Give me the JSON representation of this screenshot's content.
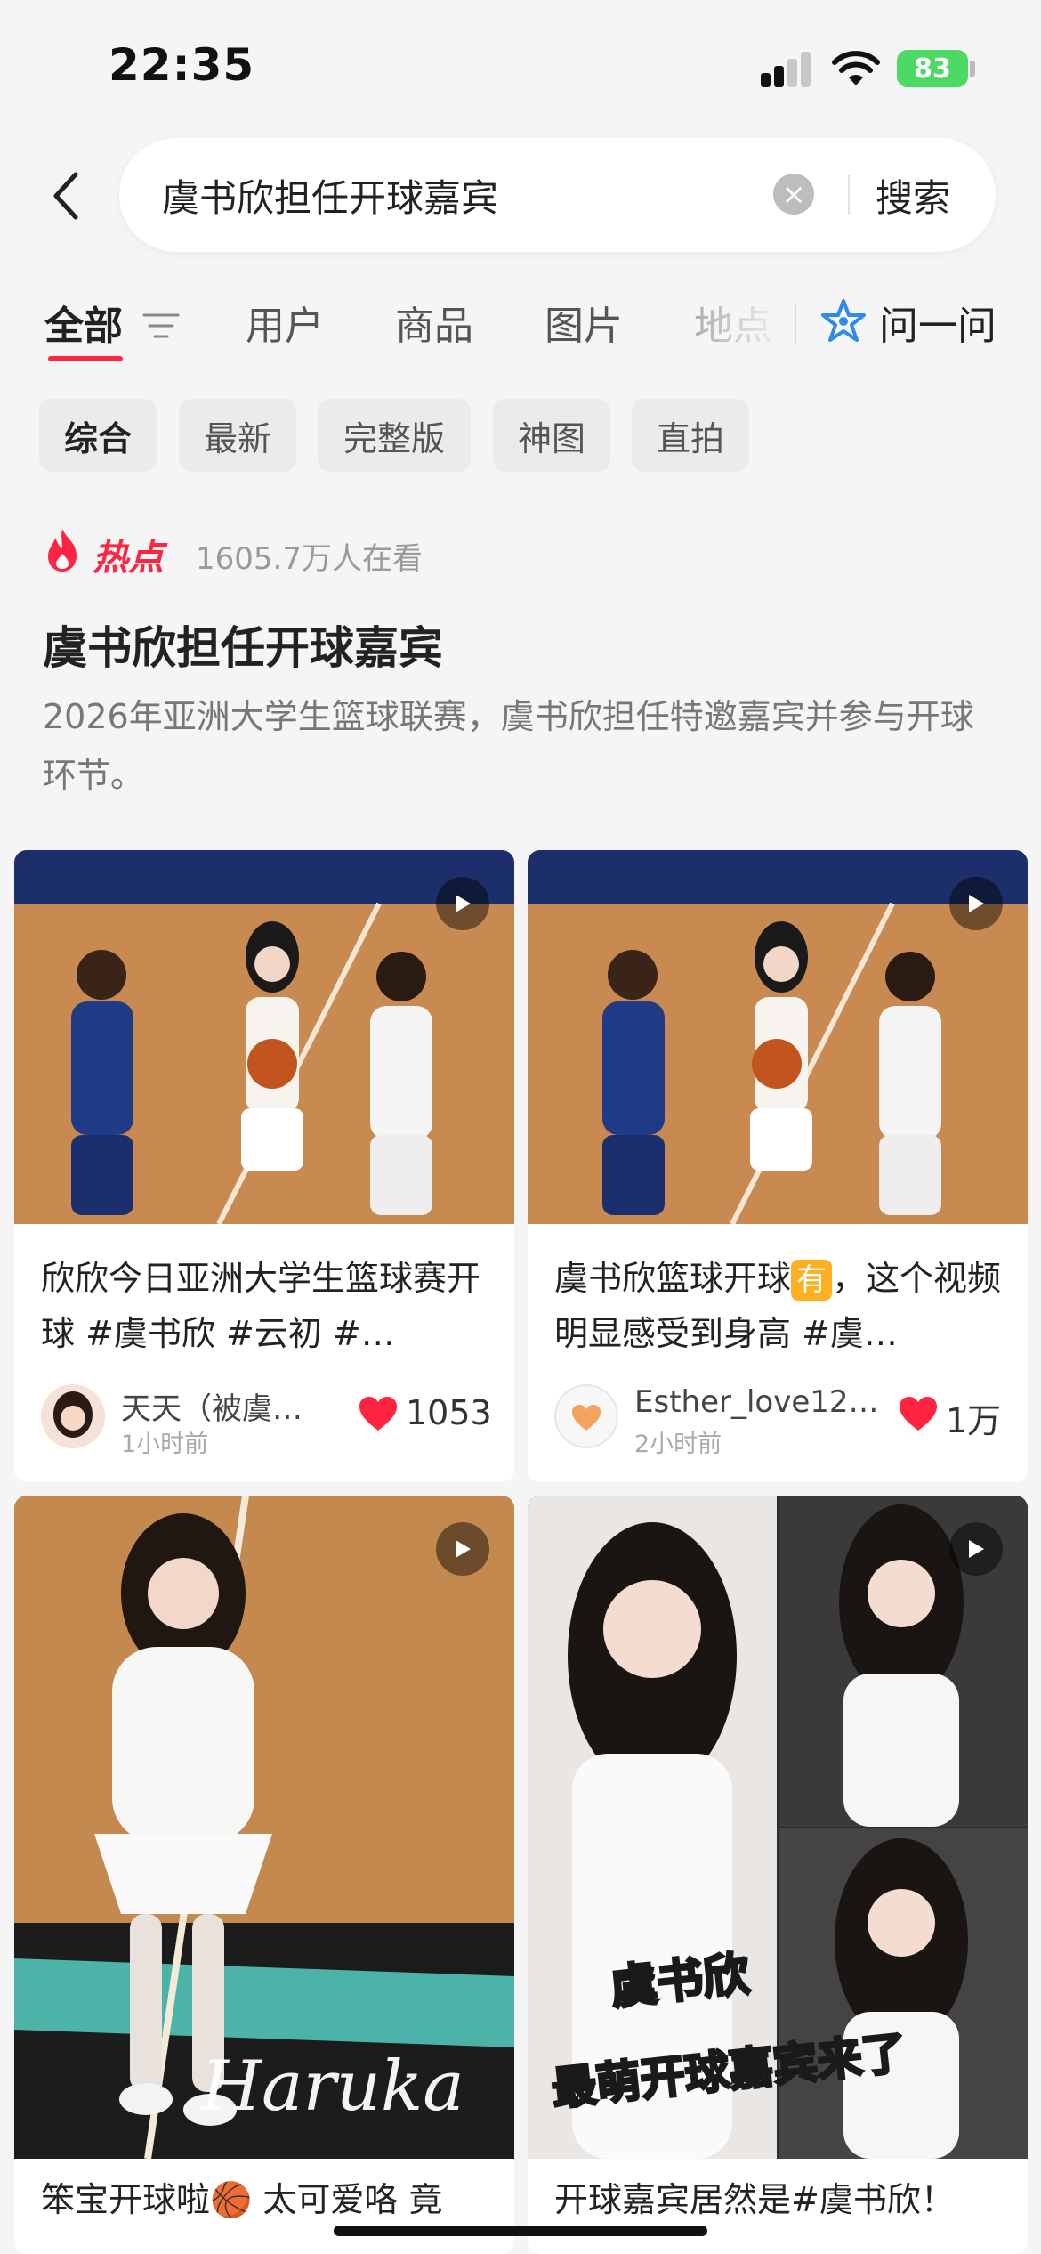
{
  "status_bar": {
    "time": "22:35",
    "battery": "83"
  },
  "search": {
    "query": "虞书欣担任开球嘉宾",
    "submit_label": "搜索"
  },
  "tabs": [
    {
      "label": "全部"
    },
    {
      "label": "用户"
    },
    {
      "label": "商品"
    },
    {
      "label": "图片"
    },
    {
      "label": "地点"
    }
  ],
  "ask": {
    "label": "问一问"
  },
  "chips": [
    {
      "label": "综合"
    },
    {
      "label": "最新"
    },
    {
      "label": "完整版"
    },
    {
      "label": "神图"
    },
    {
      "label": "直拍"
    }
  ],
  "hot": {
    "label": "热点",
    "viewers": "1605.7万人在看",
    "title": "虞书欣担任开球嘉宾",
    "description": "2026年亚洲大学生篮球联赛，虞书欣担任特邀嘉宾并参与开球环节。"
  },
  "cards": [
    {
      "title": "欣欣今日亚洲大学生篮球赛开球 #虞书欣 #云初 #…",
      "author": "天天（被虞…",
      "time": "1小时前",
      "likes": "1053"
    },
    {
      "title_pre": "虞书欣篮球开球",
      "badge": "有",
      "title_post": "，这个视频明显感受到身高 #虞…",
      "author": "Esther_love12…",
      "time": "2小时前",
      "likes": "1万"
    },
    {
      "title": "笨宝开球啦🏀 太可爱咯 竟",
      "watermark": "Haruka"
    },
    {
      "title": "开球嘉宾居然是#虞书欣！",
      "overlay_line1": "虞书欣",
      "overlay_line2": "最萌开球嘉宾来了"
    }
  ],
  "colors": {
    "accent": "#ff2442",
    "background": "#f5f5f5"
  }
}
